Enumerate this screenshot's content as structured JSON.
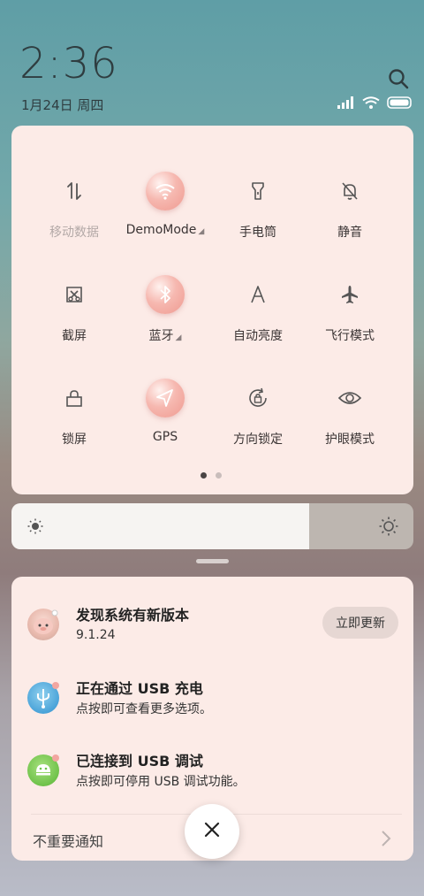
{
  "status": {
    "time": "2:36",
    "date": "1月24日 周四"
  },
  "tiles": [
    {
      "label": "移动数据",
      "icon": "mobile-data-icon",
      "active": false,
      "dim": true
    },
    {
      "label": "DemoMode",
      "icon": "wifi-icon",
      "active": true,
      "arrow": true
    },
    {
      "label": "手电筒",
      "icon": "flashlight-icon",
      "active": false
    },
    {
      "label": "静音",
      "icon": "mute-bell-icon",
      "active": false
    },
    {
      "label": "截屏",
      "icon": "screenshot-icon",
      "active": false
    },
    {
      "label": "蓝牙",
      "icon": "bluetooth-icon",
      "active": true,
      "arrow": true
    },
    {
      "label": "自动亮度",
      "icon": "auto-brightness-icon",
      "active": false
    },
    {
      "label": "飞行模式",
      "icon": "airplane-icon",
      "active": false
    },
    {
      "label": "锁屏",
      "icon": "lock-icon",
      "active": false
    },
    {
      "label": "GPS",
      "icon": "gps-icon",
      "active": true
    },
    {
      "label": "方向锁定",
      "icon": "rotation-lock-icon",
      "active": false
    },
    {
      "label": "护眼模式",
      "icon": "eye-icon",
      "active": false
    }
  ],
  "brightness": {
    "level": 0.74
  },
  "notifications": {
    "update": {
      "title": "发现系统有新版本",
      "text": "9.1.24",
      "button": "立即更新"
    },
    "usb_charge": {
      "title": "正在通过 USB 充电",
      "text": "点按即可查看更多选项。"
    },
    "usb_debug": {
      "title": "已连接到 USB 调试",
      "text": "点按即可停用 USB 调试功能。"
    },
    "unimportant": "不重要通知"
  },
  "colors": {
    "accent": "#ef9a90",
    "panel": "#fcebe7"
  }
}
